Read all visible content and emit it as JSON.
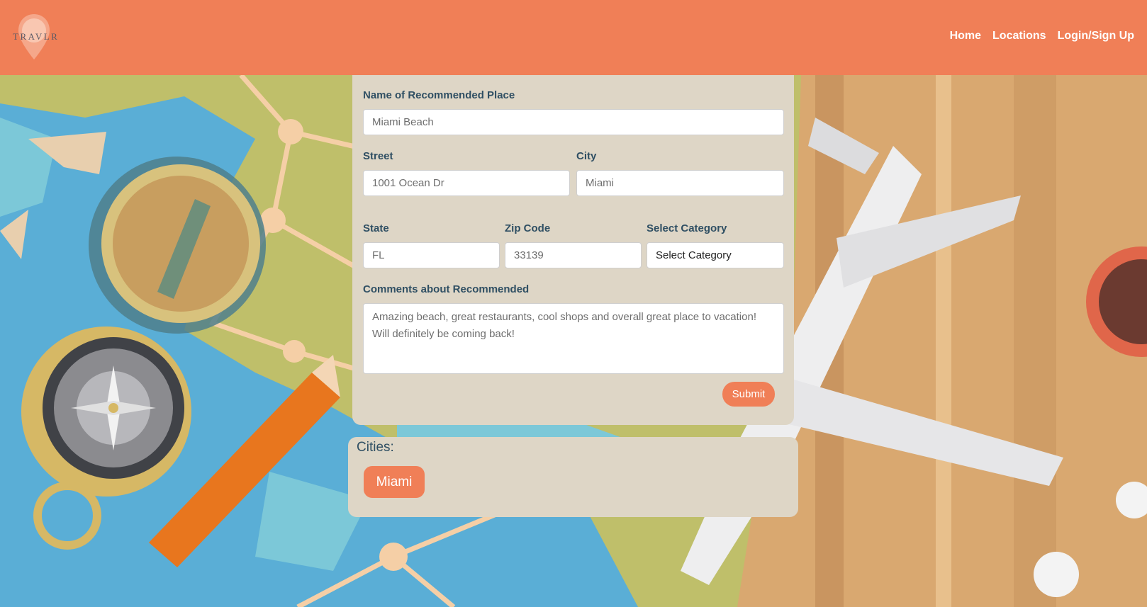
{
  "brand": {
    "name": "TRAVLR"
  },
  "nav": {
    "home": "Home",
    "locations": "Locations",
    "login": "Login/Sign Up"
  },
  "form": {
    "name_label": "Name of Recommended Place",
    "name_value": "Miami Beach",
    "street_label": "Street",
    "street_value": "1001 Ocean Dr",
    "city_label": "City",
    "city_value": "Miami",
    "state_label": "State",
    "state_value": "FL",
    "zip_label": "Zip Code",
    "zip_value": "33139",
    "category_label": "Select Category",
    "category_value": "Select Category",
    "comments_label": "Comments about Recommended",
    "comments_value": "Amazing beach, great restaurants, cool shops and overall great place to vacation! Will definitely be coming back!",
    "submit_label": "Submit"
  },
  "cities": {
    "title": "Cities:",
    "items": [
      "Miami"
    ]
  },
  "colors": {
    "accent": "#f07f57",
    "panel": "#ded6c6",
    "label": "#2f4f63"
  }
}
